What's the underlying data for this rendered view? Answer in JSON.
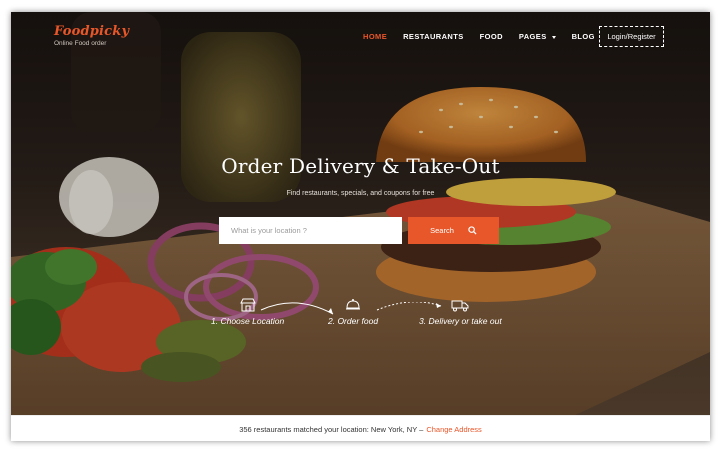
{
  "brand": {
    "logo": "Foodpicky",
    "tagline": "Online Food order"
  },
  "nav": {
    "items": [
      {
        "label": "HOME",
        "active": true
      },
      {
        "label": "RESTAURANTS",
        "active": false
      },
      {
        "label": "FOOD",
        "active": false
      },
      {
        "label": "PAGES",
        "active": false,
        "has_dropdown": true
      },
      {
        "label": "BLOG",
        "active": false
      }
    ],
    "login_label": "Login/Register"
  },
  "hero": {
    "title": "Order Delivery & Take-Out",
    "subtitle": "Find restaurants, specials, and coupons for free",
    "search": {
      "placeholder": "What is your location ?",
      "button_label": "Search"
    },
    "steps": [
      {
        "label": "1. Choose Location",
        "icon": "store-icon"
      },
      {
        "label": "2. Order food",
        "icon": "cloche-icon"
      },
      {
        "label": "3. Delivery or take out",
        "icon": "delivery-van-icon"
      }
    ]
  },
  "footer_bar": {
    "text": "356 restaurants matched your location: New York, NY –",
    "link": "Change Address"
  },
  "colors": {
    "accent": "#e8572a",
    "text_light": "#ffffff"
  }
}
